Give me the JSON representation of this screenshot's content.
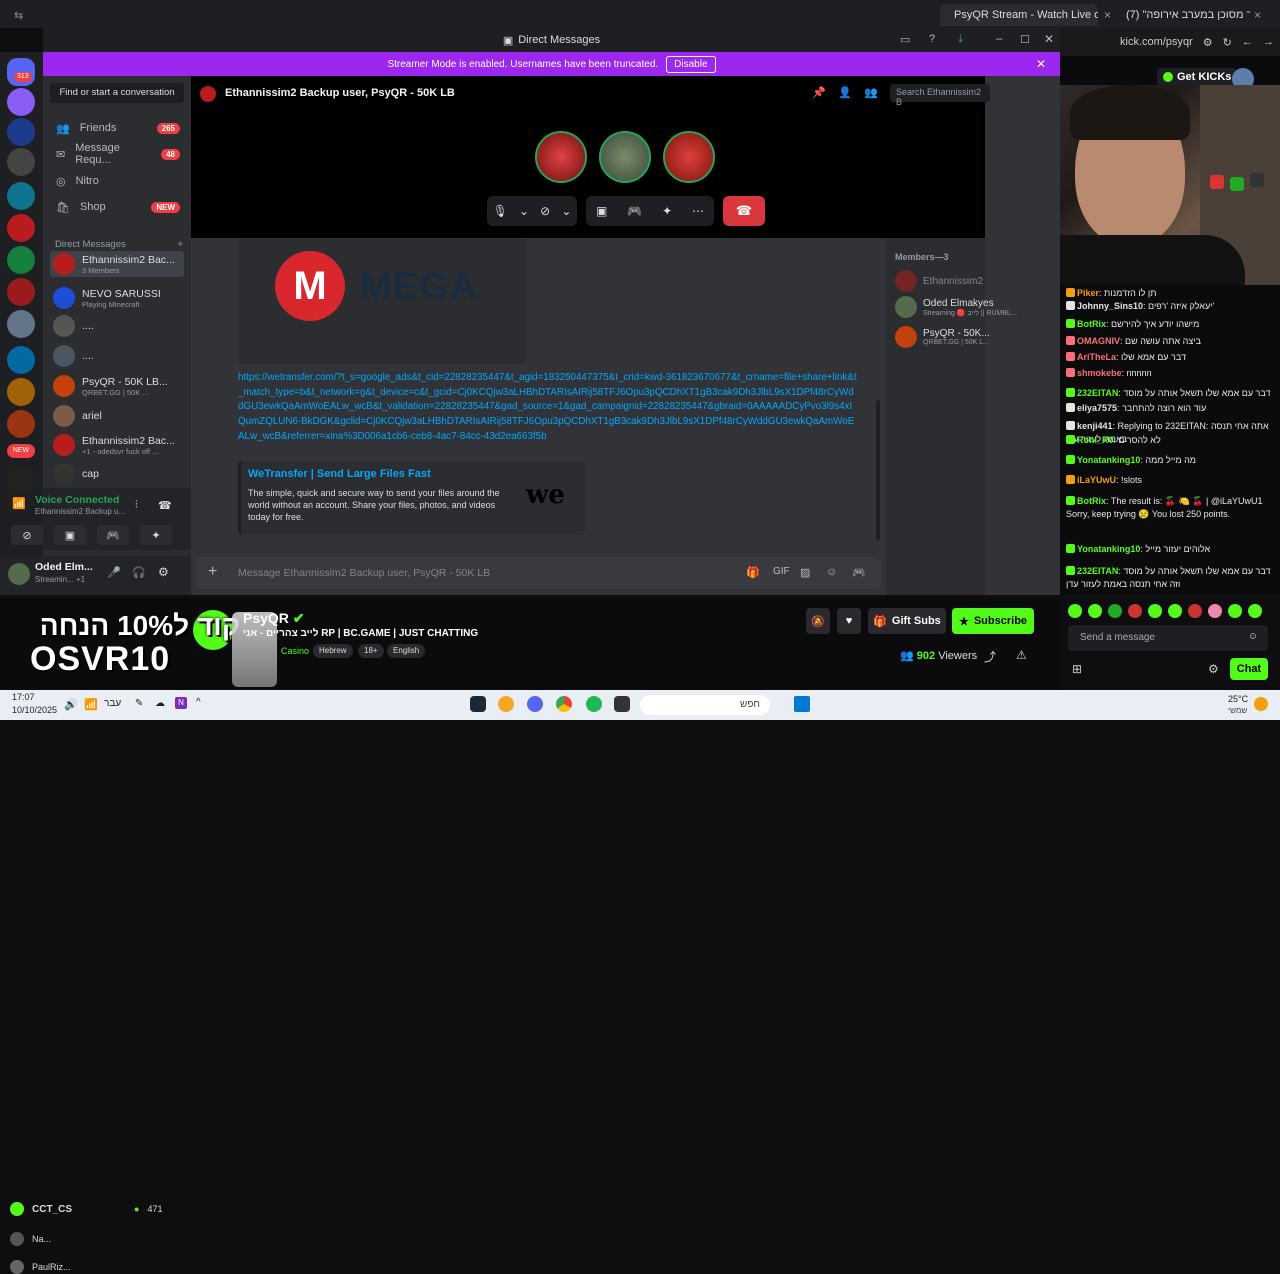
{
  "browser": {
    "tabs": [
      {
        "label": "PsyQR Stream - Watch Live on"
      },
      {
        "label": "(7) \"יותר מסוכן במערב אירופה\""
      }
    ],
    "address": "kick.com/psyqr"
  },
  "discord": {
    "window_title": "Direct Messages",
    "banner_text": "Streamer Mode is enabled. Usernames have been truncated.",
    "banner_button": "Disable",
    "find_conversation": "Find or start a conversation",
    "nav": [
      {
        "label": "Friends",
        "badge": "265"
      },
      {
        "label": "Message Requ...",
        "badge": "48"
      },
      {
        "label": "Nitro",
        "badge": ""
      },
      {
        "label": "Shop",
        "badge": "NEW"
      }
    ],
    "dm_header": "Direct Messages",
    "dm_add": "+",
    "dms": [
      {
        "name": "Ethannissim2 Bac...",
        "sub": "3 Members",
        "color": "#b91c1c"
      },
      {
        "name": "NEVO SARUSSI",
        "sub": "Playing Minecraft",
        "color": "#1d4ed8"
      },
      {
        "name": "....",
        "sub": "",
        "color": "#555"
      },
      {
        "name": "....",
        "sub": "",
        "color": "#4b5563"
      },
      {
        "name": "PsyQR - 50K LB...",
        "sub": "QRBET.GG | 50K ...",
        "color": "#c2410c"
      },
      {
        "name": "ariel",
        "sub": "",
        "color": "#7c5a4a"
      },
      {
        "name": "Ethannissim2 Bac...",
        "sub": "+1 - odedsvr fuck off ...",
        "color": "#b91c1c"
      },
      {
        "name": "cap",
        "sub": "",
        "color": "#333"
      }
    ],
    "voice": {
      "status": "Voice Connected",
      "channel": "Ethannissim2 Backup u..."
    },
    "user": {
      "name": "Oded Elm...",
      "status": "Streamin... +1"
    },
    "call": {
      "title": "Ethannissim2 Backup user, PsyQR - 50K LB",
      "search_placeholder": "Search Ethannissim2 B"
    },
    "messages": {
      "mega_logo": "M",
      "mega_text": "MEGA",
      "link": "https://wetransfer.com/?t_s=google_ads&t_cid=22828235447&t_agid=183250447375&t_crid=kwd-361823670677&t_crname=file+share+link&t_match_type=b&t_network=g&t_device=c&t_gcid=Cj0KCQjw3aLHBhDTARIsAIRij58TFJ6Opu3pQCDhXT1gB3cak9Dh3JlbL9sX1DPf48rCyWddGU3ewkQaAmWoEALw_wcB&t_validation=22828235447&gad_source=1&gad_campaignid=22828235447&gbraid=0AAAAADCyPvo3l9s4xIQumZQLUN6-BkDGK&gclid=Cj0KCQjw3aLHBhDTARIsAIRij58TFJ6Opu3pQCDhXT1gB3cak9Dh3JlbL9sX1DPf48rCyWddGU3ewkQaAmWoEALw_wcB&referrer=xina%3D006a1cb6-ceb8-4ac7-84cc-43d2ea663f5b",
      "embed_title": "WeTransfer | Send Large Files Fast",
      "embed_desc": "The simple, quick and secure way to send your files around the world without an account. Share your files, photos, and videos today for free.",
      "embed_logo": "we",
      "input_placeholder": "Message Ethannissim2 Backup user, PsyQR - 50K LB"
    },
    "members": {
      "header": "Members—3",
      "list": [
        {
          "name": "Ethannissim2",
          "sub": "",
          "color": "#b91c1c"
        },
        {
          "name": "Oded Elmakyes",
          "sub": "Streaming 🔴 לייב || RUMBL...",
          "color": "#556b4d"
        },
        {
          "name": "PsyQR - 50K...",
          "sub": "QRBET.GG | 50K L...",
          "color": "#c2410c"
        }
      ]
    }
  },
  "kick": {
    "get_kicks": "Get KICKs",
    "chat": [
      {
        "user": "Piker",
        "text": "תן לו הזדמנות",
        "color": "#f59e0b"
      },
      {
        "user": "Johnny_Sins10",
        "text": "יעאלק איזה 'רפים'",
        "color": "#e5e5e5"
      },
      {
        "user": "BotRix",
        "text": "מישהו יודע איך להירשם",
        "color": "#53fc18"
      },
      {
        "user": "OMAGNIV",
        "text": "ביצה אתה עושה שם",
        "color": "#f87171"
      },
      {
        "user": "AriTheLa",
        "text": "דבר עם אמא שלו",
        "color": "#f87171"
      },
      {
        "user": "shmokebe",
        "text": "nnnnn",
        "color": "#f87171"
      },
      {
        "user": "232EITAN",
        "text": "דבר עם אמא שלו תשאל אותה על מוסד",
        "color": "#53fc18"
      },
      {
        "user": "eliya7575",
        "text": "עוד הוא רוצה להתחבר",
        "color": "#e5e5e5"
      },
      {
        "user": "kenji441",
        "text": "Replying to 232EITAN: אתה אחי תנסה באמת לעזור עדן",
        "color": "#e5e5e5"
      },
      {
        "user": "Roni_R0",
        "text": "לא להסרים",
        "color": "#53fc18"
      },
      {
        "user": "Yonatanking10",
        "text": "מה מייל ממה",
        "color": "#53fc18"
      },
      {
        "user": "iLaYUwU",
        "text": "!slots",
        "color": "#f59e0b"
      },
      {
        "user": "BotRix",
        "text": "The result is: 🍒 🍋 🍒 | @iLaYUwU1 Sorry, keep trying 😢 You lost 250 points.",
        "color": "#53fc18"
      },
      {
        "user": "Yonatanking10",
        "text": "אלוהים יעזור מייל",
        "color": "#53fc18"
      },
      {
        "user": "232EITAN",
        "text": "דבר עם אמא שלו תשאל אותה על מוסד וזה אחי תנסה באמת לעזור עדן",
        "color": "#53fc18"
      }
    ],
    "chat_input_placeholder": "Send a message",
    "chat_button": "Chat",
    "streamer": "PsyQR",
    "title": "לייב צהריים - אני RP | BC.GAME | JUST CHATTING",
    "tags": [
      "Casino",
      "Hebrew",
      "18+",
      "English"
    ],
    "viewers_count": "902",
    "viewers_label": "Viewers",
    "gift_subs": "Gift Subs",
    "subscribe": "Subscribe",
    "promo_top": "קוד ל10% הנחה",
    "promo_code": "OSVR10",
    "left_list": [
      {
        "name": "CCT_CS",
        "count": "471"
      },
      {
        "name": "Na..."
      },
      {
        "name": "PaulRiz..."
      }
    ]
  },
  "taskbar": {
    "time": "17:07",
    "date": "10/10/2025",
    "lang": "עבר",
    "search": "חפש",
    "weather_temp": "25°C",
    "weather_label": "שמשי"
  }
}
